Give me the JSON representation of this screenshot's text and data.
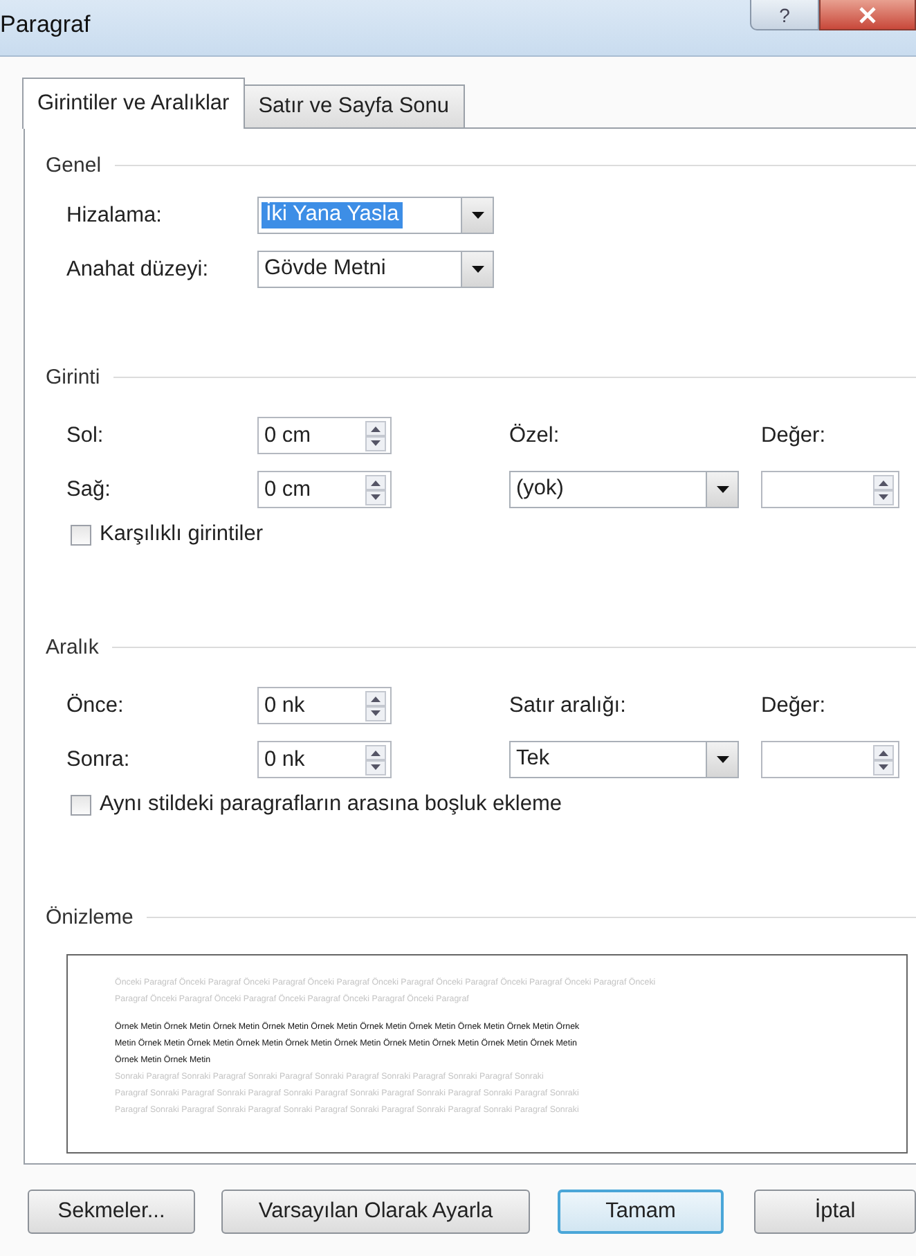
{
  "window": {
    "title": "Paragraf",
    "help_button": "?"
  },
  "tabs": [
    {
      "label": "Girintiler ve Aralıklar",
      "selected": true
    },
    {
      "label": "Satır ve Sayfa Sonu",
      "selected": false
    }
  ],
  "general": {
    "heading": "Genel",
    "rows": [
      {
        "label": "Hizalama:",
        "value": "İki Yana Yasla",
        "highlighted": true
      },
      {
        "label": "Anahat düzeyi:",
        "value": "Gövde Metni",
        "highlighted": false
      }
    ]
  },
  "indentation": {
    "heading": "Girinti",
    "rows": [
      {
        "label": "Sol:",
        "value": "0 cm",
        "side_label": "Özel:",
        "value_label": "Değer:"
      },
      {
        "label": "Sağ:",
        "value": "0 cm",
        "side_value": "(yok)"
      }
    ],
    "checkbox": {
      "label": "Karşılıklı girintiler",
      "checked": false
    }
  },
  "spacing": {
    "heading": "Aralık",
    "rows": [
      {
        "label": "Önce:",
        "value": "0 nk",
        "side_label": "Satır aralığı:",
        "value_label": "Değer:"
      },
      {
        "label": "Sonra:",
        "value": "0 nk",
        "side_value": "Tek"
      }
    ],
    "checkbox": {
      "label": "Aynı stildeki paragrafların arasına boşluk ekleme",
      "checked": false
    }
  },
  "preview": {
    "heading": "Önizleme",
    "lines": [
      {
        "kind": "before",
        "text": "Önceki Paragraf Önceki Paragraf Önceki Paragraf Önceki Paragraf Önceki Paragraf Önceki Paragraf Önceki Paragraf Önceki Paragraf Önceki"
      },
      {
        "kind": "before",
        "text": "Paragraf Önceki Paragraf Önceki Paragraf Önceki Paragraf Önceki Paragraf Önceki Paragraf"
      },
      {
        "kind": "sample",
        "text": "Örnek Metin Örnek Metin Örnek Metin Örnek Metin Örnek Metin Örnek Metin Örnek Metin Örnek Metin Örnek Metin Örnek"
      },
      {
        "kind": "sample",
        "text": "Metin Örnek Metin Örnek Metin Örnek Metin Örnek Metin Örnek Metin Örnek Metin Örnek Metin Örnek Metin Örnek Metin"
      },
      {
        "kind": "sample",
        "text": "Örnek Metin Örnek Metin"
      },
      {
        "kind": "after",
        "text": "Sonraki Paragraf Sonraki Paragraf Sonraki Paragraf Sonraki Paragraf Sonraki Paragraf Sonraki Paragraf Sonraki"
      },
      {
        "kind": "after",
        "text": "Paragraf Sonraki Paragraf Sonraki Paragraf Sonraki Paragraf Sonraki Paragraf Sonraki Paragraf Sonraki Paragraf Sonraki"
      },
      {
        "kind": "after",
        "text": "Paragraf Sonraki Paragraf Sonraki Paragraf Sonraki Paragraf Sonraki Paragraf Sonraki Paragraf Sonraki Paragraf Sonraki"
      }
    ]
  },
  "buttons": [
    {
      "label": "Sekmeler...",
      "default": false
    },
    {
      "label": "Varsayılan Olarak Ayarla",
      "default": false
    },
    {
      "label": "Tamam",
      "default": true
    },
    {
      "label": "İptal",
      "default": false
    }
  ]
}
